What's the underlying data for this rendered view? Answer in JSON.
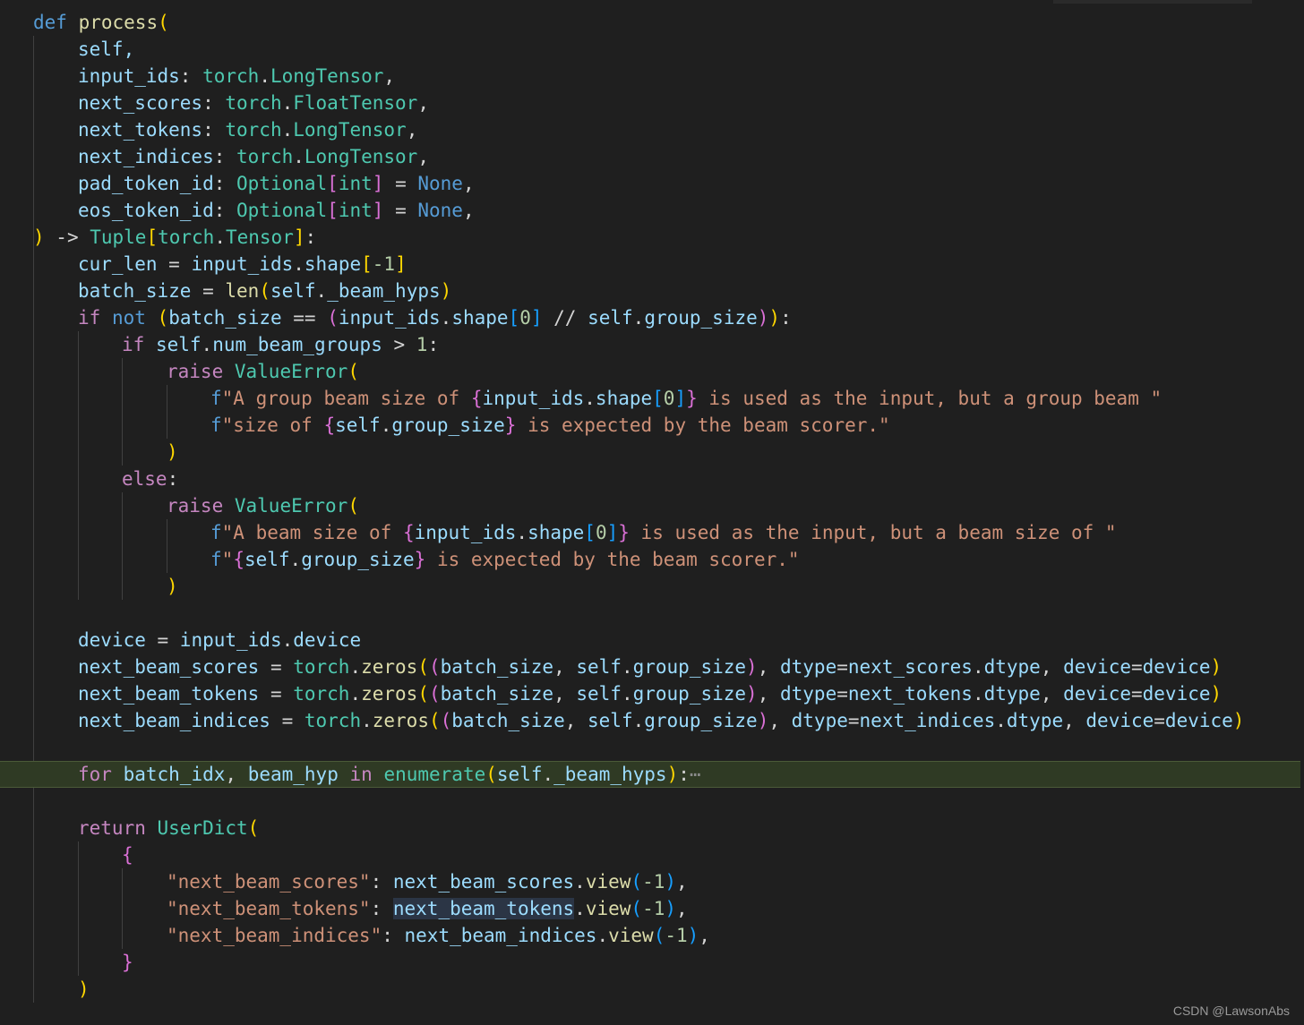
{
  "watermark": "CSDN @LawsonAbs",
  "code": {
    "l1": [
      "def",
      "process",
      "("
    ],
    "l2": "self,",
    "l3": [
      "input_ids",
      ": ",
      "torch",
      ".",
      "LongTensor",
      ","
    ],
    "l4": [
      "next_scores",
      ": ",
      "torch",
      ".",
      "FloatTensor",
      ","
    ],
    "l5": [
      "next_tokens",
      ": ",
      "torch",
      ".",
      "LongTensor",
      ","
    ],
    "l6": [
      "next_indices",
      ": ",
      "torch",
      ".",
      "LongTensor",
      ","
    ],
    "l7": [
      "pad_token_id",
      ": ",
      "Optional",
      "[",
      "int",
      "]",
      " = ",
      "None",
      ","
    ],
    "l8": [
      "eos_token_id",
      ": ",
      "Optional",
      "[",
      "int",
      "]",
      " = ",
      "None",
      ","
    ],
    "l9": [
      ")",
      " -> ",
      "Tuple",
      "[",
      "torch",
      ".",
      "Tensor",
      "]",
      ":"
    ],
    "l10": [
      "cur_len",
      " = ",
      "input_ids",
      ".",
      "shape",
      "[",
      "-1",
      "]"
    ],
    "l11": [
      "batch_size",
      " = ",
      "len",
      "(",
      "self",
      ".",
      "_beam_hyps",
      ")"
    ],
    "l12": [
      "if",
      " ",
      "not",
      " ",
      "(",
      "batch_size",
      " == ",
      "(",
      "input_ids",
      ".",
      "shape",
      "[",
      "0",
      "]",
      " // ",
      "self",
      ".",
      "group_size",
      ")",
      ")",
      ":"
    ],
    "l13": [
      "if",
      " ",
      "self",
      ".",
      "num_beam_groups",
      " > ",
      "1",
      ":"
    ],
    "l14": [
      "raise",
      " ",
      "ValueError",
      "("
    ],
    "l15": [
      "f",
      "\"A group beam size of ",
      "{",
      "input_ids",
      ".",
      "shape",
      "[",
      "0",
      "]",
      "}",
      " is used as the input, but a group beam \""
    ],
    "l16": [
      "f",
      "\"size of ",
      "{",
      "self",
      ".",
      "group_size",
      "}",
      " is expected by the beam scorer.\""
    ],
    "l17": ")",
    "l18": [
      "else",
      ":"
    ],
    "l19": [
      "raise",
      " ",
      "ValueError",
      "("
    ],
    "l20": [
      "f",
      "\"A beam size of ",
      "{",
      "input_ids",
      ".",
      "shape",
      "[",
      "0",
      "]",
      "}",
      " is used as the input, but a beam size of \""
    ],
    "l21": [
      "f",
      "\"",
      "{",
      "self",
      ".",
      "group_size",
      "}",
      " is expected by the beam scorer.\""
    ],
    "l22": ")",
    "l24": [
      "device",
      " = ",
      "input_ids",
      ".",
      "device"
    ],
    "l25": [
      "next_beam_scores",
      " = ",
      "torch",
      ".",
      "zeros",
      "(",
      "(",
      "batch_size",
      ", ",
      "self",
      ".",
      "group_size",
      ")",
      ", ",
      "dtype",
      "=",
      "next_scores",
      ".",
      "dtype",
      ", ",
      "device",
      "=",
      "device",
      ")"
    ],
    "l26": [
      "next_beam_tokens",
      " = ",
      "torch",
      ".",
      "zeros",
      "(",
      "(",
      "batch_size",
      ", ",
      "self",
      ".",
      "group_size",
      ")",
      ", ",
      "dtype",
      "=",
      "next_tokens",
      ".",
      "dtype",
      ", ",
      "device",
      "=",
      "device",
      ")"
    ],
    "l27": [
      "next_beam_indices",
      " = ",
      "torch",
      ".",
      "zeros",
      "(",
      "(",
      "batch_size",
      ", ",
      "self",
      ".",
      "group_size",
      ")",
      ", ",
      "dtype",
      "=",
      "next_indices",
      ".",
      "dtype",
      ", ",
      "device",
      "=",
      "device",
      ")"
    ],
    "l29": [
      "for",
      " ",
      "batch_idx",
      ", ",
      "beam_hyp",
      " ",
      "in",
      " ",
      "enumerate",
      "(",
      "self",
      ".",
      "_beam_hyps",
      ")",
      ":",
      "⋯"
    ],
    "l31": [
      "return",
      " ",
      "UserDict",
      "("
    ],
    "l32": "{",
    "l33": [
      "\"next_beam_scores\"",
      ": ",
      "next_beam_scores",
      ".",
      "view",
      "(",
      "-1",
      ")",
      ","
    ],
    "l34": [
      "\"next_beam_tokens\"",
      ": ",
      "next_beam_tokens",
      ".",
      "view",
      "(",
      "-1",
      ")",
      ","
    ],
    "l35": [
      "\"next_beam_indices\"",
      ": ",
      "next_beam_indices",
      ".",
      "view",
      "(",
      "-1",
      ")",
      ","
    ],
    "l36": "}",
    "l37": ")"
  }
}
